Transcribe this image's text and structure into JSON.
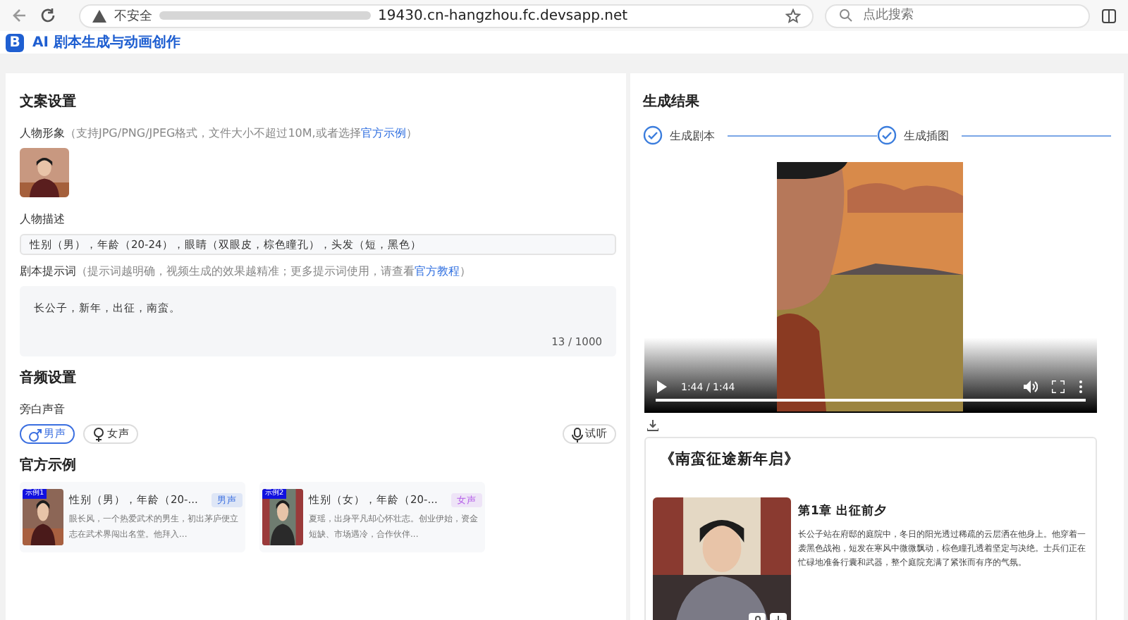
{
  "browser": {
    "security": "不安全",
    "url": "19430.cn-hangzhou.fc.devsapp.net",
    "search_placeholder": "点此搜索"
  },
  "app": {
    "logo": "B",
    "title": "AI 剧本生成与动画创作"
  },
  "copy_settings": {
    "title": "文案设置",
    "character_image": {
      "label": "人物形象",
      "hint": "（支持JPG/PNG/JPEG格式，文件大小不超过10M,或者选择",
      "link": "官方示例",
      "hint_end": "）"
    },
    "description": {
      "label": "人物描述",
      "value": "性别（男），年龄（20-24），眼睛（双眼皮，棕色瞳孔），头发（短，黑色）"
    },
    "prompt": {
      "label": "剧本提示词",
      "hint": "（提示词越明确，视频生成的效果越精准；更多提示词使用，请查看",
      "link": "官方教程",
      "hint_end": "）",
      "value": "长公子，新年，出征，南蛮。",
      "count": "13 / 1000"
    }
  },
  "audio_settings": {
    "title": "音频设置",
    "label": "旁白声音",
    "voices": [
      {
        "kind": "male",
        "label": "男声",
        "selected": true
      },
      {
        "kind": "female",
        "label": "女声",
        "selected": false
      }
    ],
    "preview": "试听"
  },
  "examples": {
    "title": "官方示例",
    "items": [
      {
        "badge": "示例1",
        "title": "性别（男），年龄（20-...",
        "tag": "男声",
        "color": "#3b6fe0",
        "text": "眼长风，一个热爱武术的男生，初出茅庐便立志在武术界闯出名堂。他拜入..."
      },
      {
        "badge": "示例2",
        "title": "性别（女），年龄（20-...",
        "tag": "女声",
        "color": "#b45ee8",
        "text": "夏瑶，出身平凡却心怀壮志。创业伊始，资金短缺、市场遇冷，合作伙伴..."
      }
    ]
  },
  "result": {
    "title": "生成结果",
    "steps": [
      {
        "label": "生成剧本",
        "done": true
      },
      {
        "label": "生成插图",
        "done": true
      }
    ],
    "video": {
      "time": "1:44 / 1:44",
      "progress": {
        "level": 1
      }
    },
    "story": {
      "title": "《南蛮征途新年启》",
      "chapter": "第1章 出征前夕",
      "text": "长公子站在府邸的庭院中，冬日的阳光透过稀疏的云层洒在他身上。他穿着一袭黑色战袍，短发在寒风中微微飘动，棕色瞳孔透着坚定与决绝。士兵们正在忙碌地准备行囊和武器，整个庭院充满了紧张而有序的气氛。"
    }
  }
}
